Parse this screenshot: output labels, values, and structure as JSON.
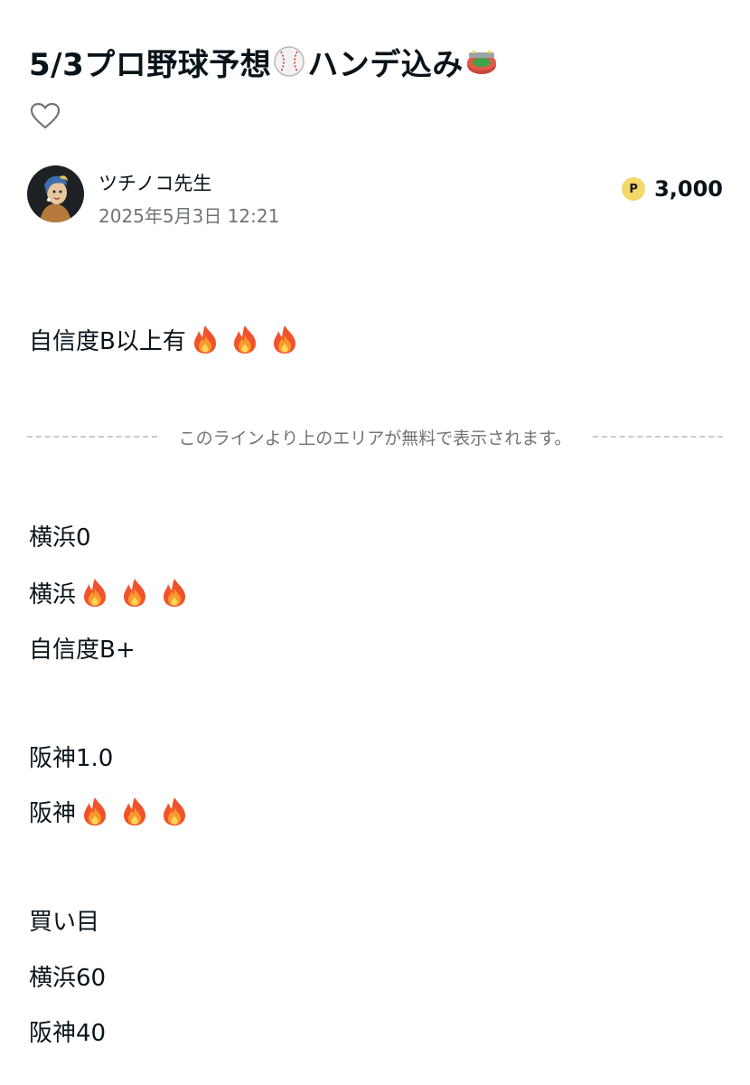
{
  "article": {
    "title_main": "5/3プロ野球予想",
    "title_tail": "ハンデ込み",
    "title_emoji_1": "baseball-emoji",
    "title_emoji_2": "stadium-emoji"
  },
  "actions": {
    "like_icon": "heart-outline-icon"
  },
  "author": {
    "name": "ツチノコ先生",
    "date": "2025年5月3日 12:21"
  },
  "price": {
    "badge": "P",
    "value": "3,000",
    "badge_color": "#f3d96a"
  },
  "free_section": {
    "lines": [
      {
        "text": "自信度B以上有",
        "flames": 3
      }
    ]
  },
  "divider": {
    "text": "このラインより上のエリアが無料で表示されます。"
  },
  "paid_section": {
    "lines": [
      {
        "text": "横浜0",
        "flames": 0
      },
      {
        "text": "横浜",
        "flames": 3
      },
      {
        "text": "自信度B+",
        "flames": 0
      },
      {
        "text": "阪神1.0",
        "flames": 0
      },
      {
        "text": "阪神",
        "flames": 3
      },
      {
        "text": "買い目",
        "flames": 0
      },
      {
        "text": "横浜60",
        "flames": 0
      },
      {
        "text": "阪神40",
        "flames": 0
      }
    ]
  },
  "colors": {
    "text": "#08131a",
    "muted": "#6e7478",
    "divider": "#c8ccce"
  }
}
